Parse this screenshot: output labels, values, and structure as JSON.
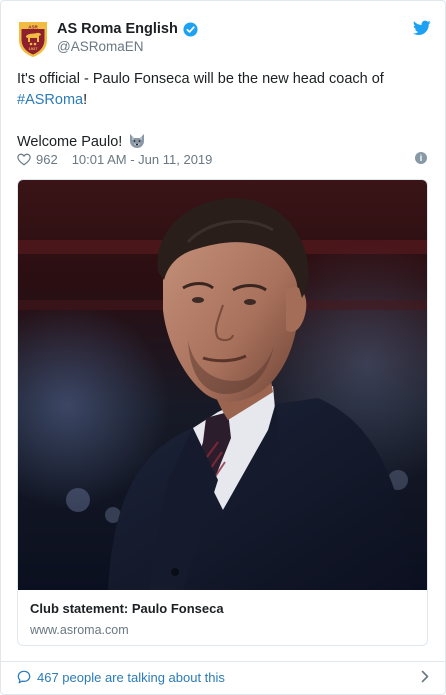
{
  "account": {
    "display_name": "AS Roma English",
    "handle": "@ASRomaEN",
    "verified": true,
    "icons": [
      "roma-crest-avatar",
      "verified-badge-icon",
      "twitter-bird-icon"
    ]
  },
  "tweet": {
    "text_before_hashtag": "It's official - Paulo Fonseca will be the new head coach of ",
    "hashtag": "#ASRoma",
    "text_after_hashtag": "!",
    "line2": "Welcome Paulo! ",
    "emoji": "wolf-emoji-icon"
  },
  "meta": {
    "likes": "962",
    "timestamp": "10:01 AM - Jun 11, 2019",
    "icons": [
      "heart-icon",
      "info-icon"
    ]
  },
  "card": {
    "image": "photo of Paulo Fonseca in dark suit",
    "title": "Club statement: Paulo Fonseca",
    "url": "www.asroma.com"
  },
  "footer": {
    "conversation_text": "467 people are talking about this",
    "icons": [
      "speech-bubble-icon",
      "chevron-right-icon"
    ]
  },
  "colors": {
    "link": "#2b7bb9",
    "muted": "#697882",
    "border": "#e1e8ed",
    "twitter_blue": "#1da1f2",
    "roma_red": "#8e1f2f",
    "roma_gold": "#f0bc42"
  }
}
